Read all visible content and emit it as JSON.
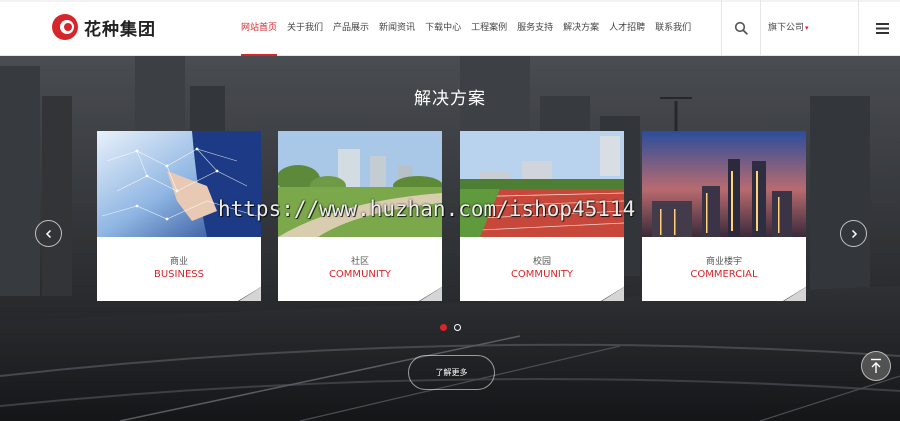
{
  "brand": {
    "name": "花种集团",
    "accent": "#d7262b"
  },
  "nav": {
    "items": [
      {
        "label": "网站首页",
        "active": true
      },
      {
        "label": "关于我们"
      },
      {
        "label": "产品展示"
      },
      {
        "label": "新闻资讯"
      },
      {
        "label": "下载中心"
      },
      {
        "label": "工程案例"
      },
      {
        "label": "服务支持"
      },
      {
        "label": "解决方案"
      },
      {
        "label": "人才招聘"
      },
      {
        "label": "联系我们"
      }
    ]
  },
  "header": {
    "search_icon": "search-icon",
    "sub_company": "旗下公司",
    "menu_icon": "hamburger-menu-icon"
  },
  "hero": {
    "title": "解决方案",
    "cards": [
      {
        "title_cn": "商业",
        "title_en": "BUSINESS",
        "image": "business-touch-image"
      },
      {
        "title_cn": "社区",
        "title_en": "COMMUNITY",
        "image": "community-park-image"
      },
      {
        "title_cn": "校园",
        "title_en": "COMMUNITY",
        "image": "campus-track-image"
      },
      {
        "title_cn": "商业楼宇",
        "title_en": "COMMERCIAL",
        "image": "city-night-image"
      }
    ],
    "more_label": "了解更多",
    "pagination": {
      "count": 2,
      "current": 1
    }
  },
  "watermark": "https://www.huzhan.com/ishop45114"
}
